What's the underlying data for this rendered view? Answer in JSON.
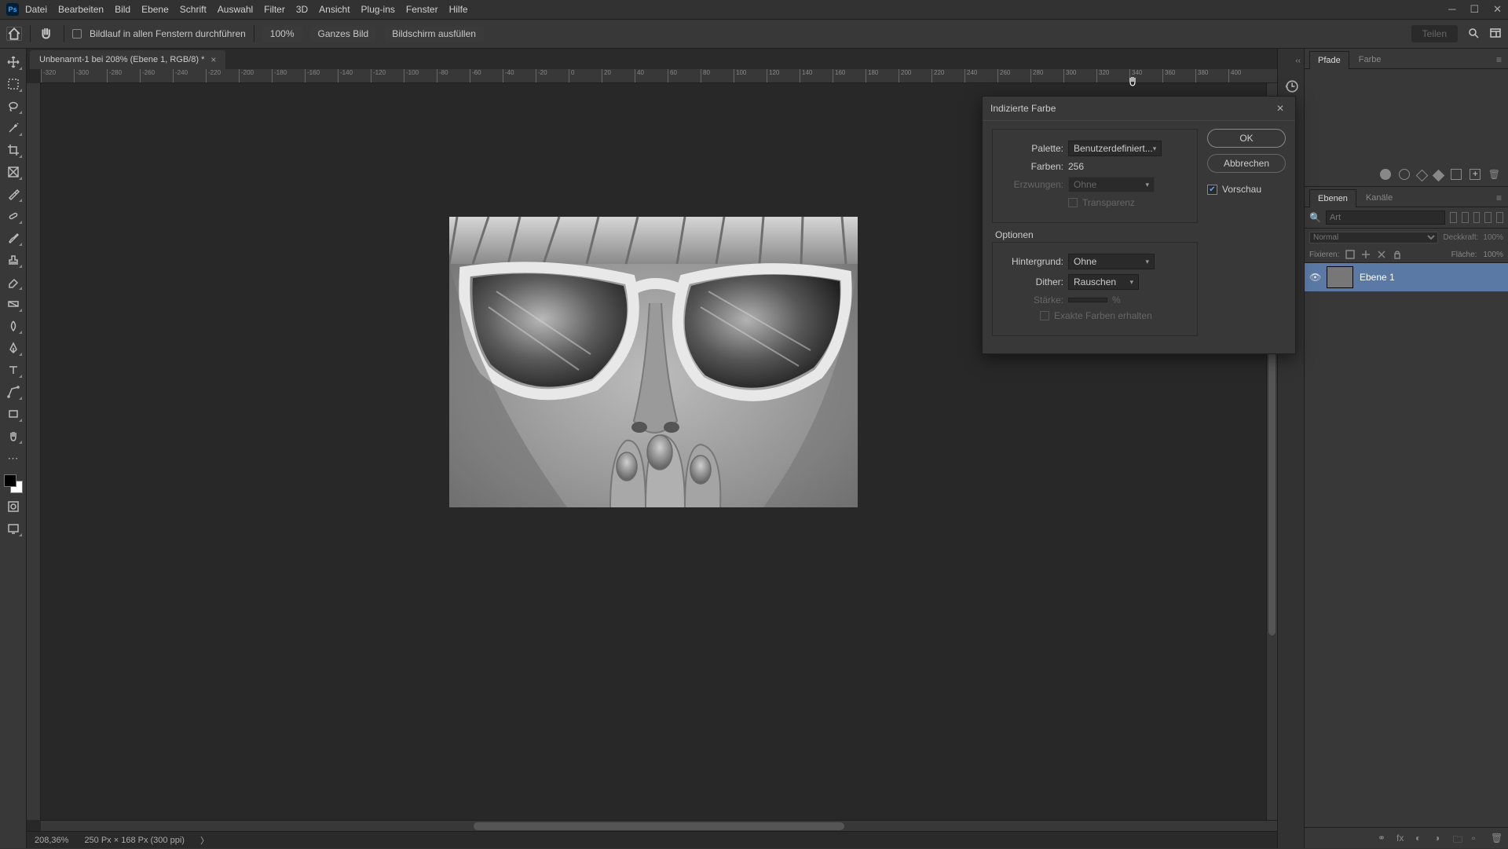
{
  "app": {
    "logo": "Ps"
  },
  "menu": [
    "Datei",
    "Bearbeiten",
    "Bild",
    "Ebene",
    "Schrift",
    "Auswahl",
    "Filter",
    "3D",
    "Ansicht",
    "Plug-ins",
    "Fenster",
    "Hilfe"
  ],
  "options": {
    "checkbox_label": "Bildlauf in allen Fenstern durchführen",
    "zoom": "100%",
    "btn1": "Ganzes Bild",
    "btn2": "Bildschirm ausfüllen",
    "share": "Teilen"
  },
  "document": {
    "tab": "Unbenannt-1 bei 208% (Ebene 1, RGB/8) *",
    "status_zoom": "208,36%",
    "status_dims": "250 Px × 168 Px (300 ppi)"
  },
  "ruler_ticks": [
    "-320",
    "-300",
    "-280",
    "-260",
    "-240",
    "-220",
    "-200",
    "-180",
    "-160",
    "-140",
    "-120",
    "-100",
    "-80",
    "-60",
    "-40",
    "-20",
    "0",
    "20",
    "40",
    "60",
    "80",
    "100",
    "120",
    "140",
    "160",
    "180",
    "200",
    "220",
    "240",
    "260",
    "280",
    "300",
    "320",
    "340",
    "360",
    "380",
    "400"
  ],
  "dialog": {
    "title": "Indizierte Farbe",
    "palette_label": "Palette:",
    "palette_value": "Benutzerdefiniert...",
    "colors_label": "Farben:",
    "colors_value": "256",
    "forced_label": "Erzwungen:",
    "forced_value": "Ohne",
    "transparency": "Transparenz",
    "options_label": "Optionen",
    "background_label": "Hintergrund:",
    "background_value": "Ohne",
    "dither_label": "Dither:",
    "dither_value": "Rauschen",
    "strength_label": "Stärke:",
    "strength_unit": "%",
    "exact": "Exakte Farben erhalten",
    "ok": "OK",
    "cancel": "Abbrechen",
    "preview": "Vorschau"
  },
  "panels": {
    "top_tabs": [
      "Pfade",
      "Farbe"
    ],
    "layer_tabs": [
      "Ebenen",
      "Kanäle"
    ],
    "search_placeholder": "Art",
    "blend_mode": "Normal",
    "opacity_label": "Deckkraft:",
    "opacity_value": "100%",
    "lock_label": "Fixieren:",
    "fill_label": "Fläche:",
    "fill_value": "100%",
    "layer_name": "Ebene 1"
  }
}
